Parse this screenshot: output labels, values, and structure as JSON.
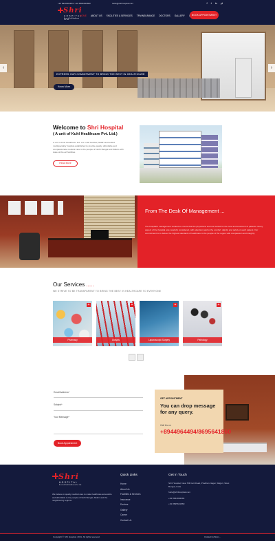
{
  "topbar": {
    "phones": "+91 8944964494 / +91 8695641860",
    "email": "hello@shrihospital.com",
    "social": [
      "f",
      "t",
      "in",
      "yt"
    ]
  },
  "brand": {
    "name": "Shri",
    "line2": "HOSPITAL",
    "line3": "A unit of Kuhl Healthcare Pvt. Ltd."
  },
  "nav": {
    "items": [
      "HOME",
      "ABOUT US",
      "FACILITIES & SERVICES",
      "TPA/INSURANCE",
      "DOCTORS",
      "GALLERY",
      "CAREER",
      "CONTACT US"
    ],
    "active_index": 0,
    "book_label": "BOOK APPOINTMENT"
  },
  "hero": {
    "tagline": "EXPRESS OUR COMMITMENT TO BRING THE BEST IN HEALTHCARE",
    "button": "Know More",
    "prev": "‹",
    "next": "›"
  },
  "welcome": {
    "title_prefix": "Welcome to ",
    "title_brand": "Shri Hospital",
    "subtitle": "( A unit of Kuhl Healthcare Pvt. Ltd.)",
    "text": "A unit of Kuhl Healthcare Pvt. Ltd. a 65 bedded, NABH-accredited multispeciality hospital established to provide quality, affordable and compassionate medical care to the people of North Bengal and Sikkim with state-of-the-art facilities.",
    "button": "Read More"
  },
  "desk": {
    "title": "From The Desk Of Management ...",
    "text": "The hospital's management worked to ensure that the physicians are best suited for the care and treatment of patients. Every aspect of the hospital was carefully considered, with attention paid to the comfort, dignity and safety of each patient. Our commitment is to deliver the highest standard of healthcare to the people of the region with compassion and integrity."
  },
  "services": {
    "title": "Our Services",
    "title_dots": " .....",
    "subtitle": "WE STRIVE TO BE TRANSPARENT TO BRING THE BEST IN HEALTHCARE TO EVERYONE",
    "items": [
      {
        "label": "Pharmacy",
        "icon": "plus-icon"
      },
      {
        "label": "Dialysis",
        "icon": "plus-icon"
      },
      {
        "label": "Laparoscopic Surgery",
        "icon": "plus-icon"
      },
      {
        "label": "Pathology",
        "icon": "plus-icon"
      }
    ]
  },
  "form": {
    "fields": [
      "Email Address*",
      "Subject*",
      "Your Message*"
    ],
    "submit": "Book Appointment"
  },
  "appointment": {
    "eyebrow": "GET APPOINTMENT",
    "title": "You can drop message for any query.",
    "call_label": "Call Us on",
    "phone": "+8944964494/8695641860"
  },
  "footer": {
    "about": "We believe in quality medical care to make healthcare accessible and affordable to the people of North Bengal, Sikkim and the neighbouring regions.",
    "links_heading": "Quick Links",
    "links": [
      "Home",
      "About Us",
      "Facilities & Services",
      "Insurance",
      "Doctors",
      "Gallery",
      "Career",
      "Contact Us"
    ],
    "touch_heading": "Get in Touch",
    "address": "Shri Hospital, Near Hill Cart Road, Pradhan Nagar, Siliguri, West Bengal, India",
    "email": "hello@shrihospital.com",
    "phone1": "+91 8944964494",
    "phone2": "+91 8695641860",
    "copyright": "Copyright © Shri Hospital. 2021. All rights reserved.",
    "credit": "Crafted by Brain..."
  },
  "colors": {
    "navy": "#141a3c",
    "red": "#e32228",
    "sand": "#f2d7b0"
  }
}
